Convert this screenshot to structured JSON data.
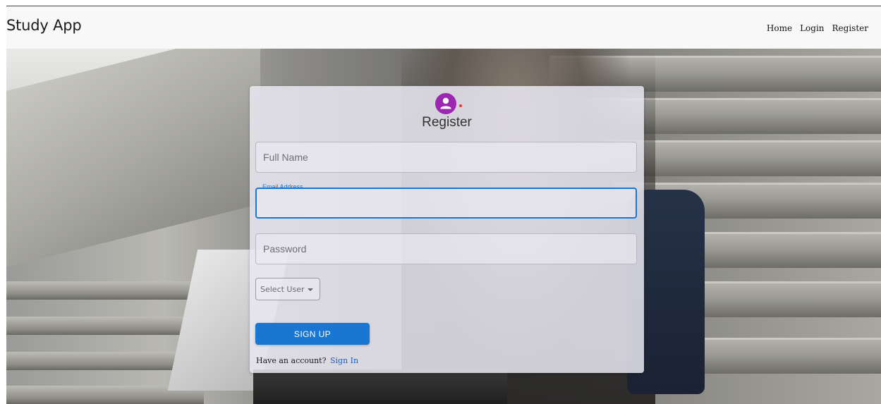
{
  "navbar": {
    "brand": "Study App",
    "links": [
      "Home",
      "Login",
      "Register"
    ]
  },
  "form": {
    "title": "Register",
    "full_name_placeholder": "Full Name",
    "email_label": "Email Address",
    "password_placeholder": "Password",
    "select_user_label": "Select User",
    "signup_label": "SIGN UP",
    "footer_text": "Have an account?",
    "signin_link": "Sign In"
  },
  "colors": {
    "accent": "#1976d2",
    "avatar": "#9c27b0"
  },
  "icons": {
    "avatar": "person-icon",
    "dropdown": "caret-down-icon"
  }
}
